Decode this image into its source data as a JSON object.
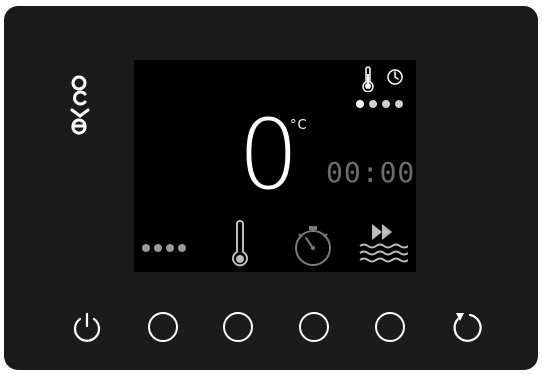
{
  "brand": {
    "logo_text": "evco"
  },
  "display": {
    "temperature_value": "0",
    "temperature_unit": "°C",
    "timer_value": "00:00",
    "top_page_dots": {
      "count": 4,
      "active_index": 0
    },
    "bottom_dots": {
      "count": 4,
      "active_index": null
    },
    "status_icons": [
      "thermometer-icon",
      "clock-icon"
    ],
    "menu_icons": [
      "thermometer-icon",
      "stopwatch-icon",
      "fast-forward-waves-icon"
    ]
  },
  "buttons": [
    {
      "name": "power-button",
      "icon": "power-icon"
    },
    {
      "name": "button-1",
      "icon": "circle-icon"
    },
    {
      "name": "button-2",
      "icon": "circle-icon"
    },
    {
      "name": "button-3",
      "icon": "circle-icon"
    },
    {
      "name": "button-4",
      "icon": "circle-icon"
    },
    {
      "name": "refresh-button",
      "icon": "refresh-icon"
    }
  ],
  "colors": {
    "panel": "#1b1b1b",
    "screen": "#000000",
    "text_active": "#ffffff",
    "text_dim": "#6d6d6d"
  }
}
